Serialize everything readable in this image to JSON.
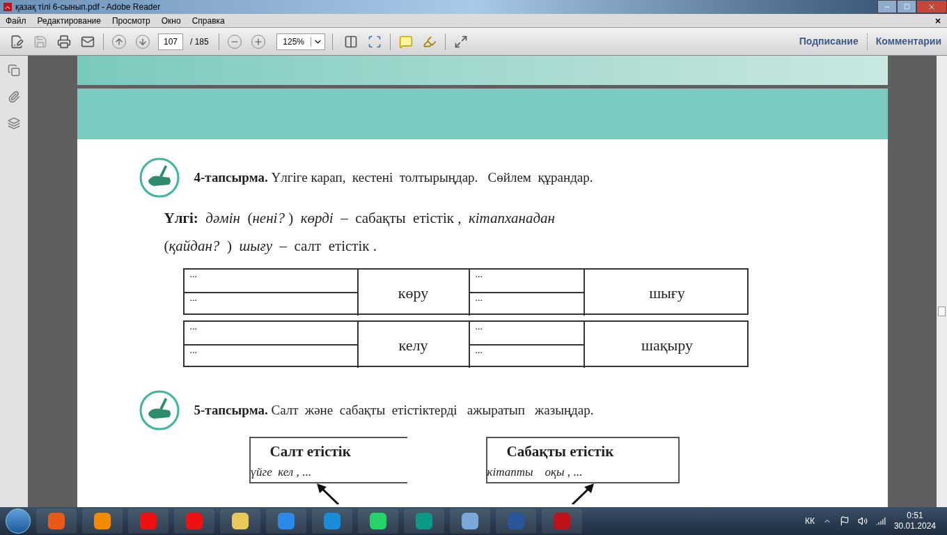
{
  "window": {
    "title": "қазақ тілі 6-сынып.pdf - Adobe Reader"
  },
  "menu": [
    "Файл",
    "Редактирование",
    "Просмотр",
    "Окно",
    "Справка"
  ],
  "toolbar": {
    "page": "107",
    "total": "/ 185",
    "zoom": "125%",
    "links": [
      "Подписание",
      "Комментарии"
    ]
  },
  "task4": {
    "number": "4-тапсырма.",
    "text": "Үлгіге карап,  кестені  толтырыңдар.   Сөйлем  құрандар.",
    "example": [
      "**Үлгі:**  *дәмін*  (*нені?* )  *көрді*  –  сабақты  етістік ,  *кітапханадан*",
      "(*қайдан?*  )  *шығу*  –  салт  етістік ."
    ],
    "tables": [
      {
        "left": [
          "...",
          "..."
        ],
        "verb1": "көру",
        "middle": [
          "...",
          "..."
        ],
        "verb2": "шығу"
      },
      {
        "left": [
          "...",
          "..."
        ],
        "verb1": "келу",
        "middle": [
          "...",
          "..."
        ],
        "verb2": "шақыру"
      }
    ]
  },
  "task5": {
    "number": "5-тапсырма.",
    "text": "Салт  және  сабақты  етістіктерді   ажыратып   жазыңдар.",
    "boxes": [
      {
        "title": "Салт  етістік",
        "example": "*үйге  кел* , ..."
      },
      {
        "title": "Сабақты  етістік",
        "example": "*кітапты*    *оқы* , ..."
      }
    ]
  },
  "taskbar": {
    "language": "КК",
    "time": "0:51",
    "date": "30.01.2024"
  }
}
